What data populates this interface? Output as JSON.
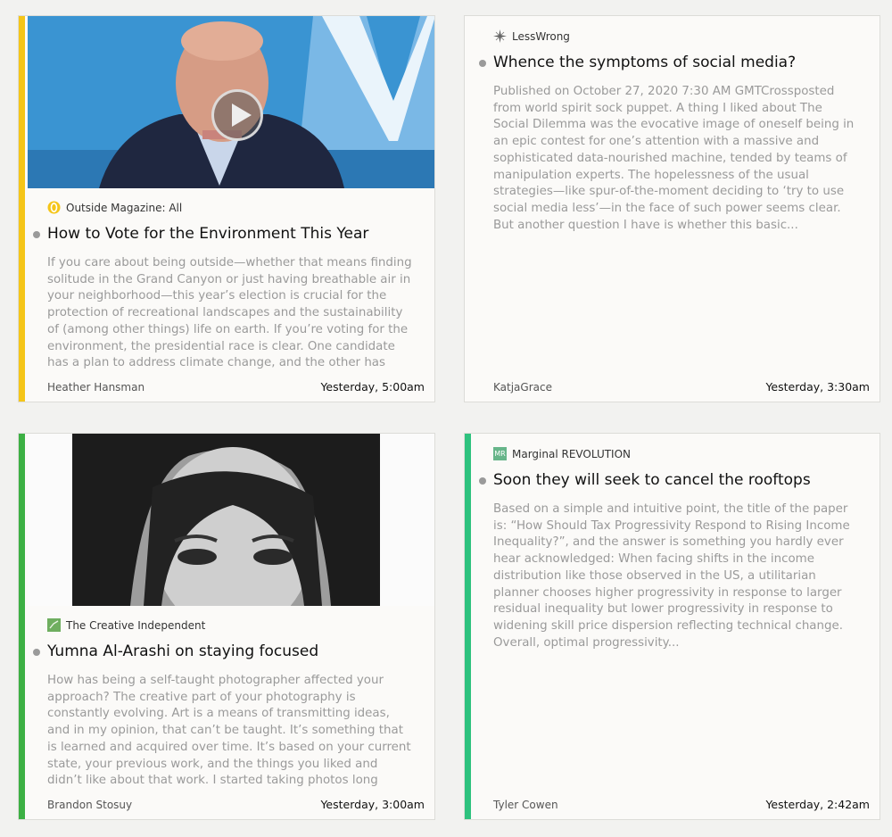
{
  "cards": [
    {
      "source": "Outside Magazine: All",
      "title": "How to Vote for the Environment This Year",
      "summary": "If you care about being outside—whether that means finding solitude in the Grand Canyon or just having breathable air in your neighborhood—this year’s election is crucial for the protection of recreational landscapes and the sustainability of (among other things) life on earth. If you’re voting for the environment, the presidential race is clear. One candidate has a plan to address climate change, and the other has",
      "author": "Heather Hansman",
      "time": "Yesterday, 5:00am",
      "accent": "#f5c518",
      "source_icon": "outside-logo-icon",
      "thumbnail": "video-thumbnail"
    },
    {
      "source": "LessWrong",
      "title": "Whence the symptoms of social media?",
      "summary": "Published on October 27, 2020 7:30 AM GMTCrossposted from world spirit sock puppet. A thing I liked about The Social Dilemma was the evocative image of oneself being in an epic contest for one’s attention with a massive and sophisticated data-nourished machine, tended by teams of manipulation experts. The hopelessness of the usual strategies—like spur-of-the-moment deciding to ‘try to use social media less’—in the face of such power seems clear. But another question I have is whether this basic...",
      "author": "KatjaGrace",
      "time": "Yesterday, 3:30am",
      "accent": "",
      "source_icon": "lesswrong-star-icon"
    },
    {
      "source": "The Creative Independent",
      "title": "Yumna Al-Arashi on staying focused",
      "summary": "How has being a self-taught photographer affected your approach? The creative part of your photography is constantly evolving. Art is a means of transmitting ideas, and in my opinion, that can’t be taught. It’s something that is learned and acquired over time. It’s based on your current state, your previous work, and the things you liked and didn’t like about that work. I started taking photos long before I was heading",
      "author": "Brandon Stosuy",
      "time": "Yesterday, 3:00am",
      "accent": "#3cb043",
      "source_icon": "creative-independent-icon",
      "thumbnail": "portrait-photo"
    },
    {
      "source": "Marginal REVOLUTION",
      "title": "Soon they will seek to cancel the rooftops",
      "summary": "Based on a simple and intuitive point, the title of the paper is: “How Should Tax Progressivity Respond to Rising Income Inequality?”, and the answer is something you hardly ever hear acknowledged: When facing shifts in the income distribution like those observed in the US, a utilitarian planner chooses higher progressivity in response to larger residual inequality but lower progressivity in response to widening skill price dispersion reflecting technical change. Overall, optimal progressivity...",
      "author": "Tyler Cowen",
      "time": "Yesterday, 2:42am",
      "accent": "#2ec27e",
      "source_icon": "mr-logo-icon",
      "source_icon_text": "MR"
    }
  ]
}
